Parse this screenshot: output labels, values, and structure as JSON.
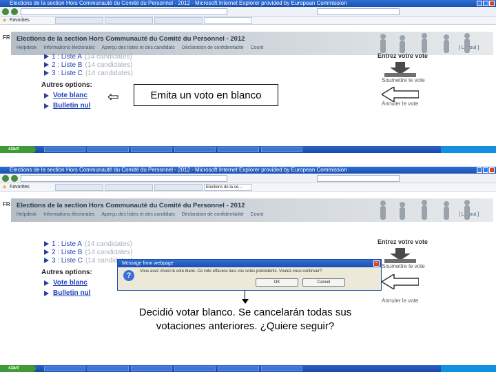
{
  "browser": {
    "window_title": "Elections de la section Hors Communauté du Comité du Personnel - 2012 - Microsoft Internet Explorer provided by European Commission",
    "favorites_label": "Favorites",
    "tab_label": "Elections de la se...",
    "start_label": "start"
  },
  "page": {
    "language_label": "FR",
    "header_title": "Elections de la section Hors Communauté du Comité du Personnel - 2012",
    "menu": [
      "Helpdesk",
      "Informations électorales",
      "Aperçu des listes et des candidats",
      "Déclaration de confidentialité",
      "Count"
    ],
    "logout_label": "[ Logout ]",
    "lists": [
      {
        "label": "1 : Liste A",
        "candidates": "(14 candidates)"
      },
      {
        "label": "2 : Liste B",
        "candidates": "(14 candidates)"
      },
      {
        "label": "3 : Liste C",
        "candidates": "(14 candidates)"
      }
    ],
    "options_title": "Autres options:",
    "options": [
      "Vote blanc",
      "Bulletin nul"
    ],
    "right_panel": {
      "title": "Entrez votre vote",
      "submit_label": "Soumettre le vote",
      "cancel_label": "Annuler le vote"
    }
  },
  "callouts": {
    "blank_vote_hint": "Emita un voto en blanco",
    "confirmation_caption": "Decidió votar blanco. Se cancelarán todas sus votaciones anteriores. ¿Quiere seguir?"
  },
  "dialog": {
    "title": "Message from webpage",
    "message": "Vous avez choisi le vote blanc. Ce vote effacera tous vos votes précédents. Voulez-vous continuer?",
    "ok_label": "OK",
    "cancel_label": "Cancel"
  },
  "colors": {
    "link_blue": "#2244bb",
    "xp_title_blue": "#1c4fb0",
    "start_green": "#3e9a34"
  }
}
